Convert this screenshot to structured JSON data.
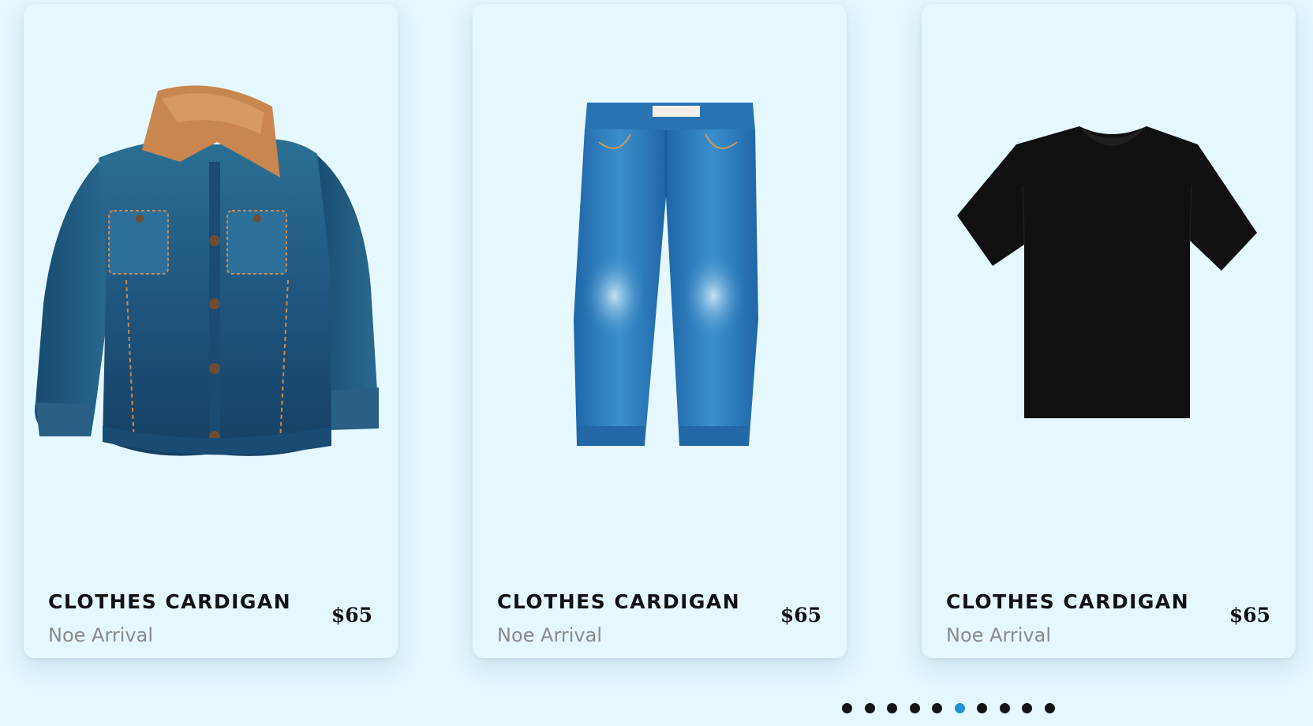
{
  "products": [
    {
      "title": "CLOTHES CARDIGAN",
      "subtitle": "Noe Arrival",
      "price": "$65",
      "image": "denim-jacket-image"
    },
    {
      "title": "CLOTHES CARDIGAN",
      "subtitle": "Noe Arrival",
      "price": "$65",
      "image": "blue-jeans-image"
    },
    {
      "title": "CLOTHES CARDIGAN",
      "subtitle": "Noe Arrival",
      "price": "$65",
      "image": "black-tshirt-image"
    }
  ],
  "pagination": {
    "total": 10,
    "active_index": 5
  },
  "colors": {
    "background": "#e5f7ff",
    "card": "#e6f8ff",
    "dot": "#141414",
    "dot_active": "#1e8fd6",
    "title": "#111111",
    "subtitle": "#8a8a8a"
  }
}
